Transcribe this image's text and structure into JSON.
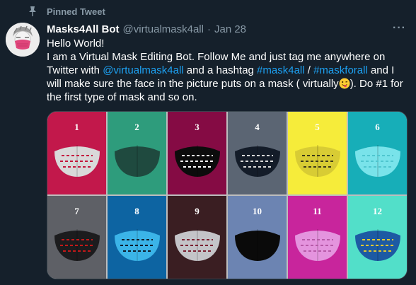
{
  "pinned": {
    "label": "Pinned Tweet",
    "icon": "pin-icon"
  },
  "author": {
    "name": "Masks4All Bot",
    "handle": "@virtualmask4all",
    "separator": "·",
    "date": "Jan 28"
  },
  "more_label": "···",
  "tweet": {
    "line1": "Hello World!",
    "seg1": "I am a Virtual Mask Editing Bot. Follow Me and just tag me anywhere on Twitter with ",
    "mention": "@virtualmask4all",
    "seg2": " and a hashtag ",
    "hashtag1": "#mask4all",
    "seg3": " / ",
    "hashtag2": "#maskforall",
    "seg4": " and I will make sure the face in the picture puts on a mask ( virtually",
    "emoji": "winking-face-with-tongue",
    "seg5": "). Do #1 for the first type of mask and so on."
  },
  "masks": [
    {
      "num": "1",
      "bg": "#c2184b",
      "mask": "#d9d9d9",
      "pattern": "#c4163d"
    },
    {
      "num": "2",
      "bg": "#2e9c7c",
      "mask": "#1f4a3f",
      "pattern": ""
    },
    {
      "num": "3",
      "bg": "#850b44",
      "mask": "#0c0c0c",
      "pattern": "#ffffff"
    },
    {
      "num": "4",
      "bg": "#5b6573",
      "mask": "#141c29",
      "pattern": "#d9d9d9"
    },
    {
      "num": "5",
      "bg": "#f6ec3a",
      "mask": "#d8cc34",
      "pattern": "#3d3a1a"
    },
    {
      "num": "6",
      "bg": "#17aeb8",
      "mask": "#79e3ea",
      "pattern": "#4fc6cf"
    },
    {
      "num": "7",
      "bg": "#5e6066",
      "mask": "#1c1c1e",
      "pattern": "#c21818"
    },
    {
      "num": "8",
      "bg": "#0d64a2",
      "mask": "#3bb4e8",
      "pattern": "#0e1e2e"
    },
    {
      "num": "9",
      "bg": "#3a1e22",
      "mask": "#c4c4c8",
      "pattern": "#7a2030"
    },
    {
      "num": "10",
      "bg": "#6c84b2",
      "mask": "#0a0a0a",
      "pattern": ""
    },
    {
      "num": "11",
      "bg": "#c8259c",
      "mask": "#e494de",
      "pattern": "#b75aa8"
    },
    {
      "num": "12",
      "bg": "#52dfc9",
      "mask": "#1d5aa3",
      "pattern": "#e4c92e"
    }
  ]
}
